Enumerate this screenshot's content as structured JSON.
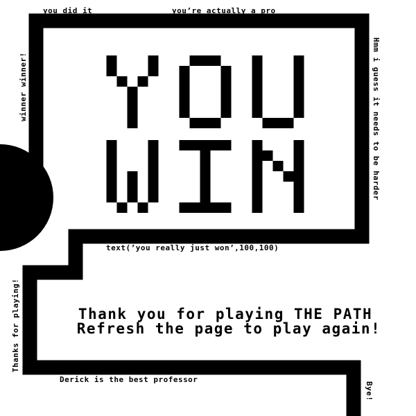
{
  "title": "YOU WIN",
  "labels": {
    "top_left": "you did it",
    "top_center": "you’re actually a pro",
    "left_vertical": "winner winner!",
    "right_vertical": "Hmm i guess it needs to be harder",
    "mid_caption": "text(’you really just won’,100,100)",
    "lower_left_vertical": "Thanks for playing!",
    "bottom": "Derick is the best professor",
    "bottom_right_vertical": "Bye!"
  },
  "message": {
    "line1": "Thank you for playing THE PATH",
    "line2": "Refresh the page to play again!"
  },
  "colors": {
    "background": "#ffffff",
    "foreground": "#000000"
  }
}
